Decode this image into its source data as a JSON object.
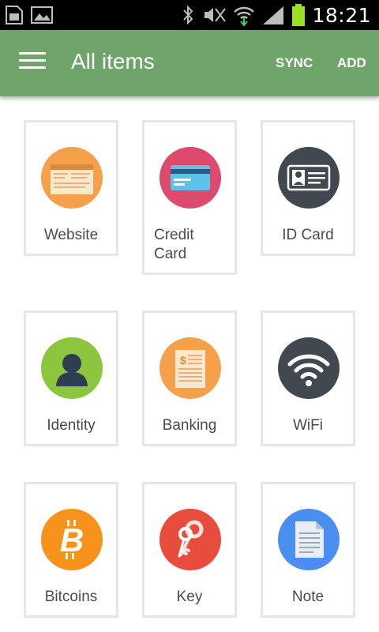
{
  "status_bar": {
    "time": "18:21",
    "left_icons": [
      "sim-card-icon",
      "gallery-icon"
    ],
    "right_icons": [
      "bluetooth-icon",
      "mute-icon",
      "wifi-icon",
      "signal-icon",
      "battery-icon"
    ]
  },
  "app_bar": {
    "title": "All items",
    "actions": [
      "SYNC",
      "ADD"
    ],
    "color": "#6fa46a"
  },
  "items": [
    {
      "label": "Website",
      "icon": "website-icon",
      "color": "#f5a04a"
    },
    {
      "label": "Credit Card",
      "line1": "Credit",
      "line2": "Card",
      "icon": "credit-card-icon",
      "color": "#de4a6d"
    },
    {
      "label": "ID Card",
      "icon": "id-card-icon",
      "color": "#414850"
    },
    {
      "label": "Identity",
      "icon": "identity-icon",
      "color": "#8cc63f"
    },
    {
      "label": "Banking",
      "icon": "banking-icon",
      "color": "#f5a04a"
    },
    {
      "label": "WiFi",
      "icon": "wifi-icon",
      "color": "#414850"
    },
    {
      "label": "Bitcoins",
      "icon": "bitcoin-icon",
      "color": "#f7931a"
    },
    {
      "label": "Key",
      "icon": "key-icon",
      "color": "#e84c3d"
    },
    {
      "label": "Note",
      "icon": "note-icon",
      "color": "#4a8ef0"
    }
  ]
}
